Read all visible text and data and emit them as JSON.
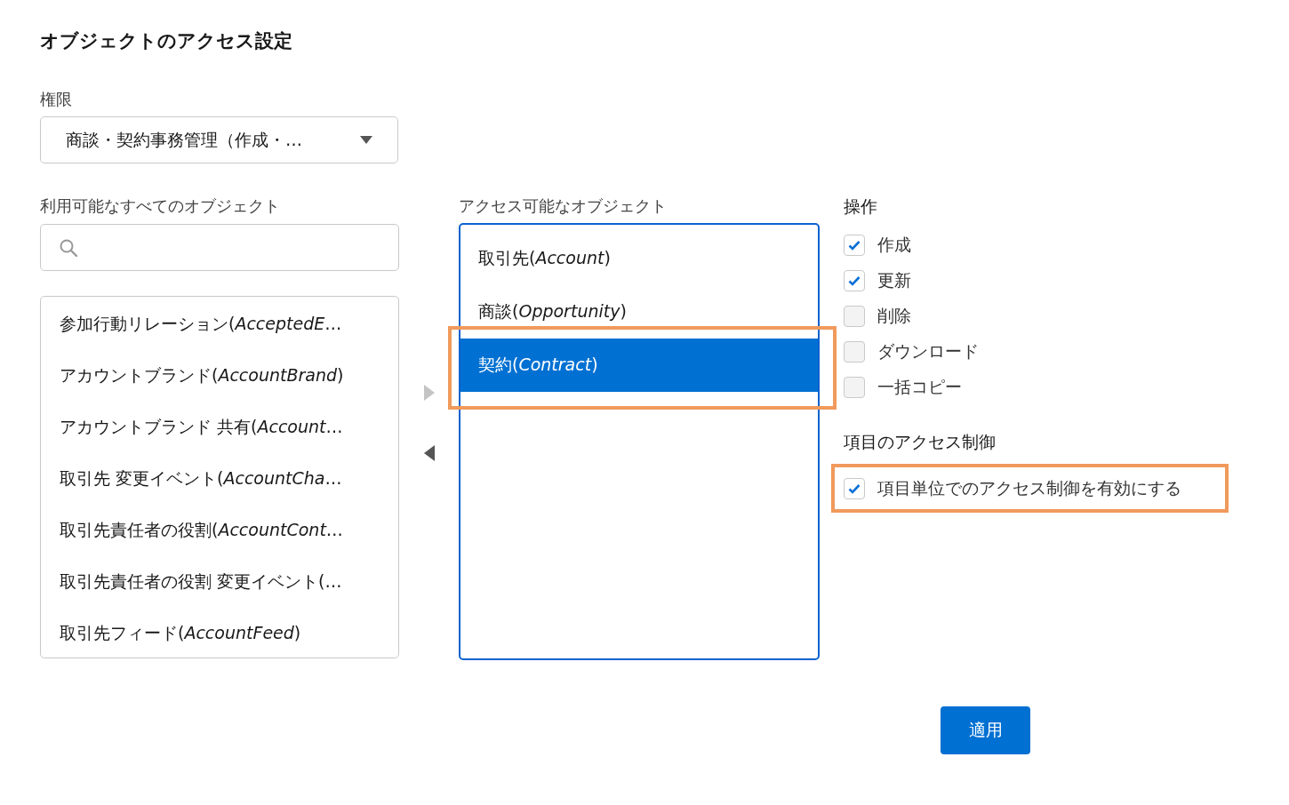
{
  "title": "オブジェクトのアクセス設定",
  "permission": {
    "label": "権限",
    "value": "商談・契約事務管理（作成・…"
  },
  "available": {
    "label": "利用可能なすべてのオブジェクト",
    "items": [
      {
        "text": "参加行動リレーション(*AcceptedE*…"
      },
      {
        "text": "アカウントブランド(*AccountBrand*)"
      },
      {
        "text": "アカウントブランド 共有(*Account*…"
      },
      {
        "text": "取引先 変更イベント(*AccountCha*…"
      },
      {
        "text": "取引先責任者の役割(*AccountCont*…"
      },
      {
        "text": "取引先責任者の役割 変更イベント(…"
      },
      {
        "text": "取引先フィード(*AccountFeed*)"
      }
    ]
  },
  "move_buttons": [
    {
      "kind": "add",
      "disabled": true
    },
    {
      "kind": "remove",
      "disabled": false
    }
  ],
  "accessible": {
    "label": "アクセス可能なオブジェクト",
    "items": [
      {
        "text": "取引先(*Account*)",
        "selected": false,
        "highlighted": false
      },
      {
        "text": "商談(*Opportunity*)",
        "selected": false,
        "highlighted": false
      },
      {
        "text": "契約(*Contract*)",
        "selected": true,
        "highlighted": true
      }
    ]
  },
  "operations": {
    "heading": "操作",
    "items": [
      {
        "label": "作成",
        "checked": true
      },
      {
        "label": "更新",
        "checked": true
      },
      {
        "label": "削除",
        "checked": false
      },
      {
        "label": "ダウンロード",
        "checked": false
      },
      {
        "label": "一括コピー",
        "checked": false
      }
    ]
  },
  "field_access": {
    "heading": "項目のアクセス制御",
    "option": {
      "label": "項目単位でのアクセス制御を有効にする",
      "checked": true,
      "highlighted": true
    }
  },
  "apply_button": "適用"
}
